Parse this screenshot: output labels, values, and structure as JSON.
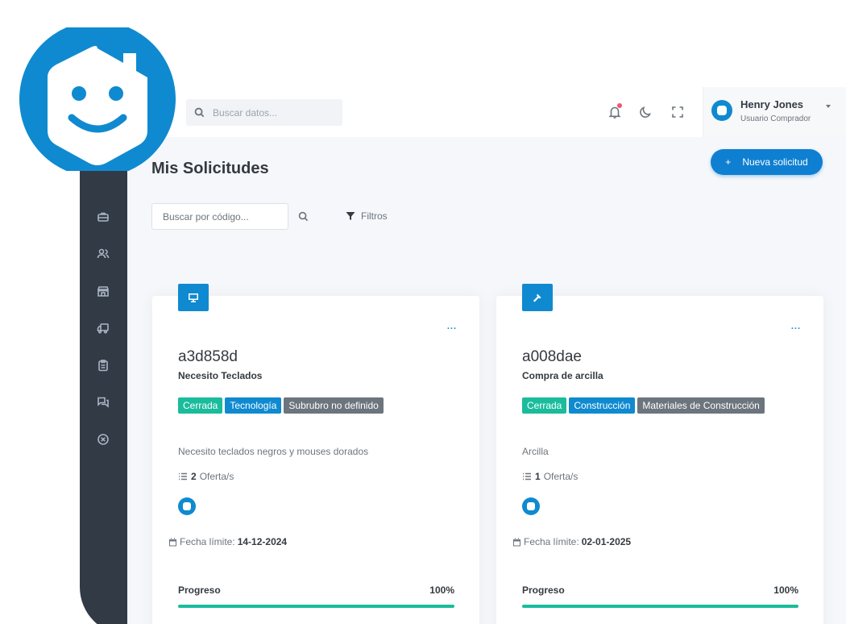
{
  "topbar": {
    "search_placeholder": "Buscar datos...",
    "user": {
      "name": "Henry Jones",
      "role": "Usuario Comprador"
    }
  },
  "page": {
    "title": "Mis Solicitudes",
    "new_button": "Nueva solicitud",
    "new_button_icon": "+",
    "code_search_placeholder": "Buscar por código...",
    "filters_label": "Filtros"
  },
  "sidebar": {
    "items": [
      {
        "icon": "briefcase-icon"
      },
      {
        "icon": "users-icon"
      },
      {
        "icon": "store-icon"
      },
      {
        "icon": "truck-icon"
      },
      {
        "icon": "clipboard-icon"
      },
      {
        "icon": "chat-icon"
      },
      {
        "icon": "close-circle-icon"
      }
    ]
  },
  "requests": [
    {
      "icon": "monitor-icon",
      "menu": "...",
      "code": "a3d858d",
      "title": "Necesito Teclados",
      "tags": [
        "Cerrada",
        "Tecnología",
        "Subrubro no definido"
      ],
      "description": "Necesito teclados negros y mouses dorados",
      "offers_count": "2",
      "offers_label": "Oferta/s",
      "deadline_label": "Fecha límite:",
      "deadline": "14-12-2024",
      "progress_label": "Progreso",
      "progress_text": "100%",
      "progress": 1.0
    },
    {
      "icon": "hammer-icon",
      "menu": "...",
      "code": "a008dae",
      "title": "Compra de arcilla",
      "tags": [
        "Cerrada",
        "Construcción",
        "Materiales de Construcción"
      ],
      "description": "Arcilla",
      "offers_count": "1",
      "offers_label": "Oferta/s",
      "deadline_label": "Fecha límite:",
      "deadline": "02-01-2025",
      "progress_label": "Progreso",
      "progress_text": "100%",
      "progress": 1.0
    }
  ],
  "colors": {
    "brand": "#0f8ad0",
    "success": "#1abc9c",
    "sidebar": "#323a46",
    "muted": "#6c757d"
  }
}
